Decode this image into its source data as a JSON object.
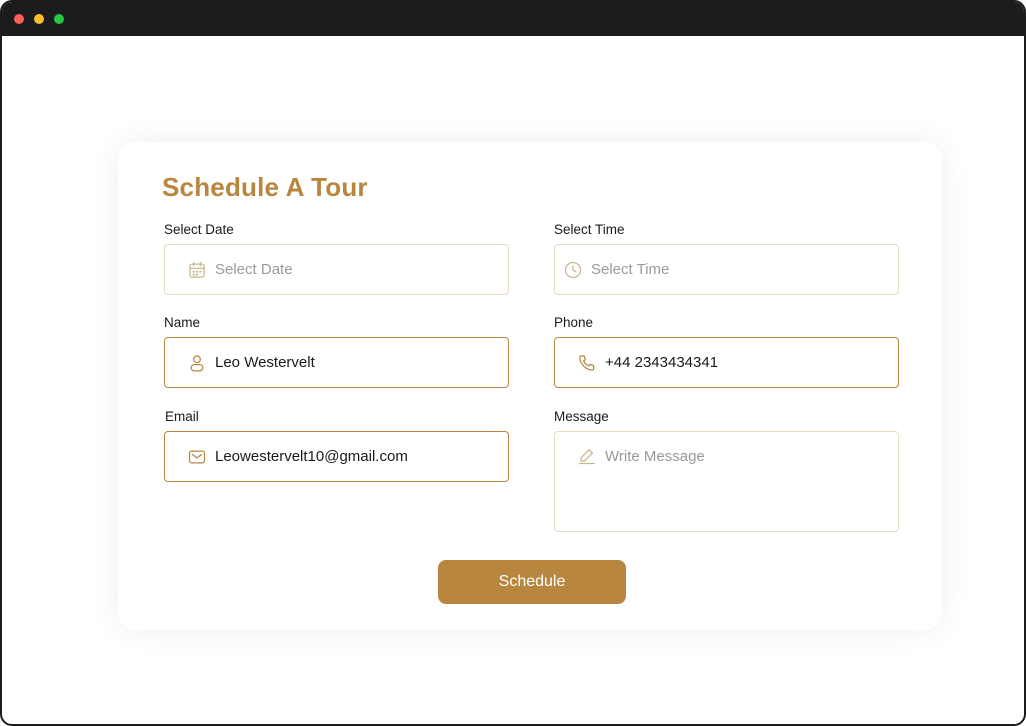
{
  "form": {
    "title": "Schedule A Tour",
    "date": {
      "label": "Select Date",
      "placeholder": "Select Date",
      "value": ""
    },
    "time": {
      "label": "Select Time",
      "placeholder": "Select Time",
      "value": ""
    },
    "name": {
      "label": "Name",
      "placeholder": "",
      "value": "Leo Westervelt"
    },
    "phone": {
      "label": "Phone",
      "placeholder": "",
      "value": "+44 2343434341"
    },
    "email": {
      "label": "Email",
      "placeholder": "",
      "value": "Leowestervelt10@gmail.com"
    },
    "message": {
      "label": "Message",
      "placeholder": "Write Message",
      "value": ""
    },
    "submit_label": "Schedule"
  },
  "icons": {
    "date": "calendar-icon",
    "time": "clock-icon",
    "name": "user-icon",
    "phone": "phone-icon",
    "email": "mail-icon",
    "message": "pencil-icon"
  },
  "colors": {
    "accent": "#b8863f",
    "field_border": "#e6dcc5",
    "titlebar": "#1c1c1c"
  }
}
